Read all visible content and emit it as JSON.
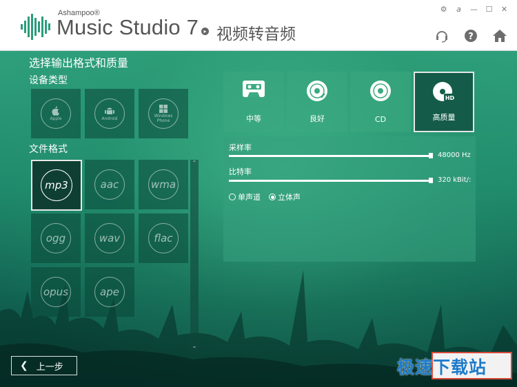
{
  "header": {
    "brand_small": "Ashampoo®",
    "brand_main": "Music Studio 7",
    "title": "视频转音频",
    "window_controls": [
      "settings-icon",
      "about-icon",
      "minimize-icon",
      "maximize-icon",
      "close-icon"
    ],
    "toolbar_icons": [
      "support-icon",
      "help-icon",
      "home-icon"
    ]
  },
  "main": {
    "section_title": "选择输出格式和质量",
    "device_label": "设备类型",
    "devices": [
      {
        "name": "Apple",
        "icon": "apple-icon"
      },
      {
        "name": "Android",
        "icon": "android-icon"
      },
      {
        "name": "Windows Phone",
        "icon": "windows-icon"
      }
    ],
    "format_label": "文件格式",
    "formats": [
      "mp3",
      "aac",
      "wma",
      "ogg",
      "wav",
      "flac",
      "opus",
      "ape"
    ],
    "selected_format": "mp3"
  },
  "quality": {
    "presets": [
      {
        "label": "中等",
        "icon": "cassette-icon"
      },
      {
        "label": "良好",
        "icon": "vinyl-icon"
      },
      {
        "label": "CD",
        "icon": "cd-icon"
      },
      {
        "label": "高质量",
        "icon": "hd-disc-icon"
      }
    ],
    "selected": "高质量",
    "sample_rate_label": "采样率",
    "sample_rate_value": "48000 Hz",
    "sample_rate_level": 1.0,
    "bitrate_label": "比特率",
    "bitrate_value": "320 kBit/:",
    "bitrate_level": 1.0,
    "channels": [
      {
        "label": "单声道",
        "checked": false
      },
      {
        "label": "立体声",
        "checked": true
      }
    ]
  },
  "footer": {
    "back_label": "上一步",
    "watermark": "极速下载站"
  },
  "colors": {
    "accent": "#1f8a6c",
    "watermark": "#1e7bc9",
    "highlight_border": "#d84a3a"
  }
}
